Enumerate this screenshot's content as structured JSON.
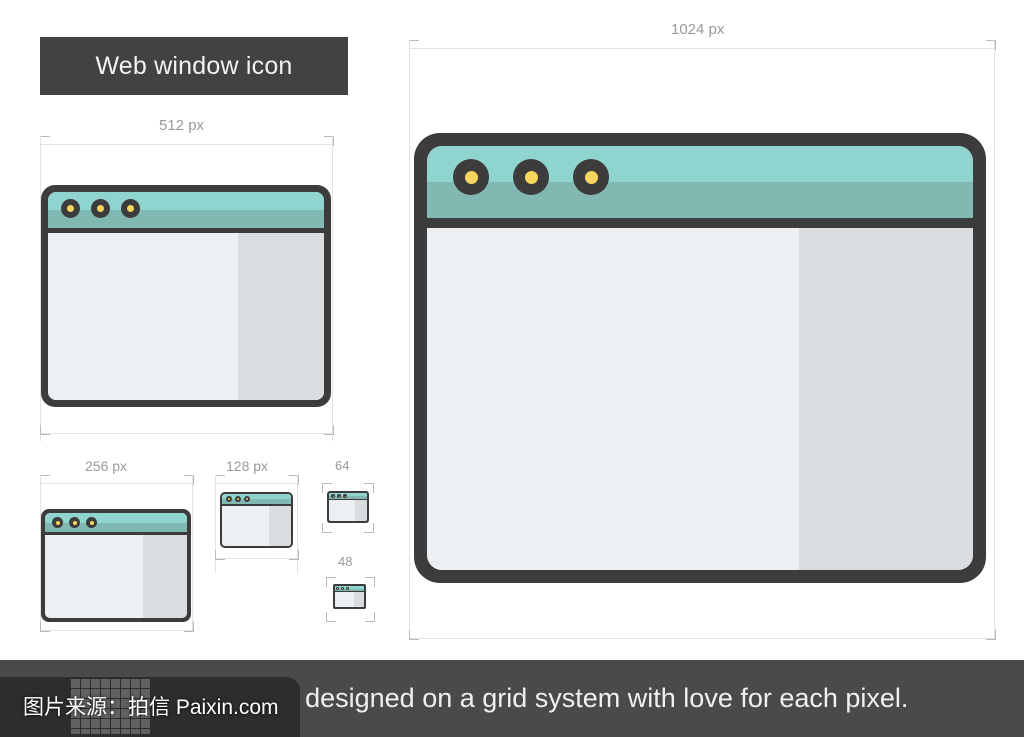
{
  "title_banner": {
    "label": "Web window icon"
  },
  "footer": {
    "caption": "Scalable icon designed on a grid system with love for each pixel."
  },
  "watermark": {
    "text": "图片来源：拍信 Paixin.com",
    "icon": "grid-icon"
  },
  "colors": {
    "icon_outline": "#3c3c3c",
    "titlebar_light": "#8fd4ce",
    "titlebar_dark": "#82b8b2",
    "dot_outer": "#3c3c3c",
    "dot_inner": "#f8d55c",
    "body_light": "#ecf0f2",
    "body_shade": "#d9dddf",
    "banner_bg": "#424242",
    "footer_bg": "#4a4a4a",
    "guide_line": "#e2e2e2",
    "guide_text": "#9a9a9a"
  },
  "specimens": [
    {
      "id": "primary",
      "size_label": "1024 px",
      "dots": 3
    },
    {
      "id": "s512",
      "size_label": "512 px",
      "dots": 3
    },
    {
      "id": "s256",
      "size_label": "256 px",
      "dots": 3
    },
    {
      "id": "s128",
      "size_label": "128 px",
      "dots": 3
    },
    {
      "id": "s64",
      "size_label": "64",
      "dots": 3
    },
    {
      "id": "s48",
      "size_label": "48",
      "dots": 3
    }
  ]
}
